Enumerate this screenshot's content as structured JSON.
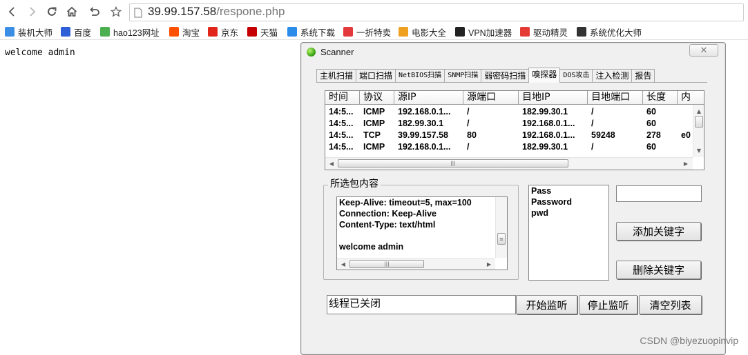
{
  "browser": {
    "url_host": "39.99.157.58",
    "url_path": "/respone.php",
    "bookmarks": [
      {
        "label": "装机大师",
        "icon": "globe-icon",
        "color": "#3a8ee6"
      },
      {
        "label": "百度",
        "icon": "baidu-paw-icon",
        "color": "#2e5fd6"
      },
      {
        "label": "hao123网址",
        "icon": "hao123-icon",
        "color": "#4caf50"
      },
      {
        "label": "淘宝",
        "icon": "taobao-icon",
        "color": "#ff5000"
      },
      {
        "label": "京东",
        "icon": "jd-icon",
        "color": "#e1251b"
      },
      {
        "label": "天猫",
        "icon": "tmall-icon",
        "color": "#c40000"
      },
      {
        "label": "系统下载",
        "icon": "globe-icon",
        "color": "#2b8be8"
      },
      {
        "label": "一折特卖",
        "icon": "sale-icon",
        "color": "#e4393c"
      },
      {
        "label": "电影大全",
        "icon": "film-reel-icon",
        "color": "#f0a020"
      },
      {
        "label": "VPN加速器",
        "icon": "vpn-icon",
        "color": "#222222"
      },
      {
        "label": "驱动精灵",
        "icon": "driver-icon",
        "color": "#e53935"
      },
      {
        "label": "系统优化大师",
        "icon": "optimizer-icon",
        "color": "#333333"
      }
    ]
  },
  "page": {
    "body_text": "welcome admin"
  },
  "scanner": {
    "title": "Scanner",
    "tabs": [
      {
        "label": "主机扫描",
        "mono": false,
        "active": false
      },
      {
        "label": "端口扫描",
        "mono": false,
        "active": false
      },
      {
        "label": "NetBIOS扫描",
        "mono": true,
        "active": false
      },
      {
        "label": "SNMP扫描",
        "mono": true,
        "active": false
      },
      {
        "label": "弱密码扫描",
        "mono": false,
        "active": false
      },
      {
        "label": "嗅探器",
        "mono": false,
        "active": true
      },
      {
        "label": "DOS攻击",
        "mono": true,
        "active": false
      },
      {
        "label": "注入检测",
        "mono": false,
        "active": false
      },
      {
        "label": "报告",
        "mono": false,
        "active": false
      }
    ],
    "packet_table": {
      "columns": [
        "时间",
        "协议",
        "源IP",
        "源端口",
        "目地IP",
        "目地端口",
        "长度",
        "内"
      ],
      "rows": [
        [
          "14:5...",
          "ICMP",
          "192.168.0.1...",
          "/",
          "182.99.30.1",
          "/",
          "60",
          ""
        ],
        [
          "14:5...",
          "ICMP",
          "182.99.30.1",
          "/",
          "192.168.0.1...",
          "/",
          "60",
          ""
        ],
        [
          "14:5...",
          "TCP",
          "39.99.157.58",
          "80",
          "192.168.0.1...",
          "59248",
          "278",
          "e0"
        ],
        [
          "14:5...",
          "ICMP",
          "192.168.0.1...",
          "/",
          "182.99.30.1",
          "/",
          "60",
          ""
        ]
      ]
    },
    "content_group_label": "所选包内容",
    "packet_content_lines": [
      "Keep-Alive: timeout=5, max=100",
      "Connection: Keep-Alive",
      "Content-Type: text/html",
      "",
      "welcome admin"
    ],
    "keywords": [
      "Pass",
      "Password",
      "pwd"
    ],
    "keyword_input_value": "",
    "add_keyword_label": "添加关键字",
    "delete_keyword_label": "删除关键字",
    "status_text": "线程已关闭",
    "start_label": "开始监听",
    "stop_label": "停止监听",
    "clear_label": "清空列表"
  },
  "watermark": "CSDN @biyezuopinvip"
}
